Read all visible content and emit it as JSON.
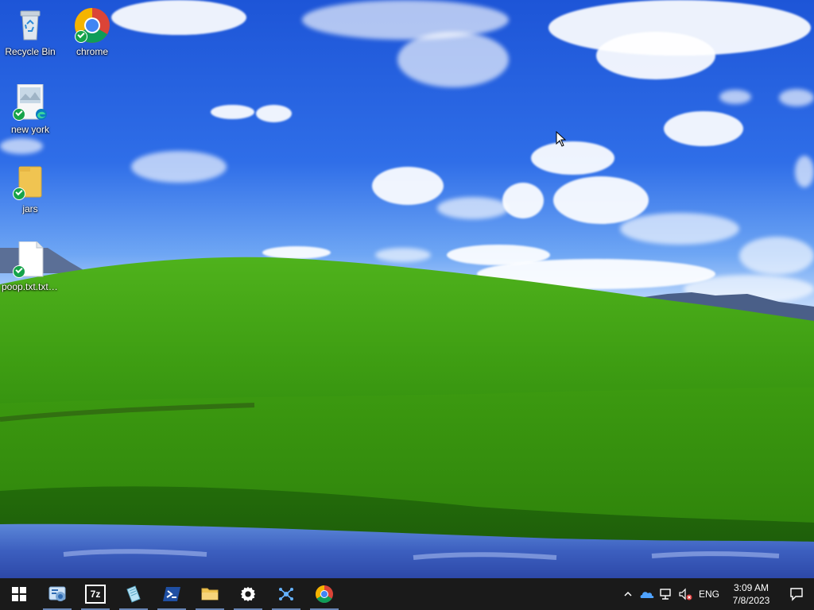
{
  "desktop": {
    "icons": [
      {
        "label": "Recycle Bin",
        "icon": "recycle-bin-icon"
      },
      {
        "label": "chrome",
        "icon": "chrome-icon"
      },
      {
        "label": "new york",
        "icon": "image-file-icon"
      },
      {
        "label": "jars",
        "icon": "folder-icon"
      },
      {
        "label": "poop.txt.txt.txt...",
        "icon": "text-file-icon"
      }
    ]
  },
  "taskbar": {
    "apps": [
      {
        "name": "start",
        "icon": "windows-logo-icon"
      },
      {
        "name": "control-panel",
        "icon": "control-panel-icon"
      },
      {
        "name": "7zip",
        "icon": "7zip-icon",
        "text": "7z"
      },
      {
        "name": "notepad",
        "icon": "notepad-icon"
      },
      {
        "name": "powershell",
        "icon": "powershell-icon"
      },
      {
        "name": "file-explorer",
        "icon": "folder-icon"
      },
      {
        "name": "settings",
        "icon": "gear-icon"
      },
      {
        "name": "network-app",
        "icon": "network-app-icon"
      },
      {
        "name": "chrome",
        "icon": "chrome-icon"
      }
    ],
    "tray": {
      "language": "ENG",
      "time": "3:09 AM",
      "date": "7/8/2023"
    }
  },
  "colors": {
    "taskbar": "#1a1a1a",
    "accent_green": "#16a34a"
  }
}
